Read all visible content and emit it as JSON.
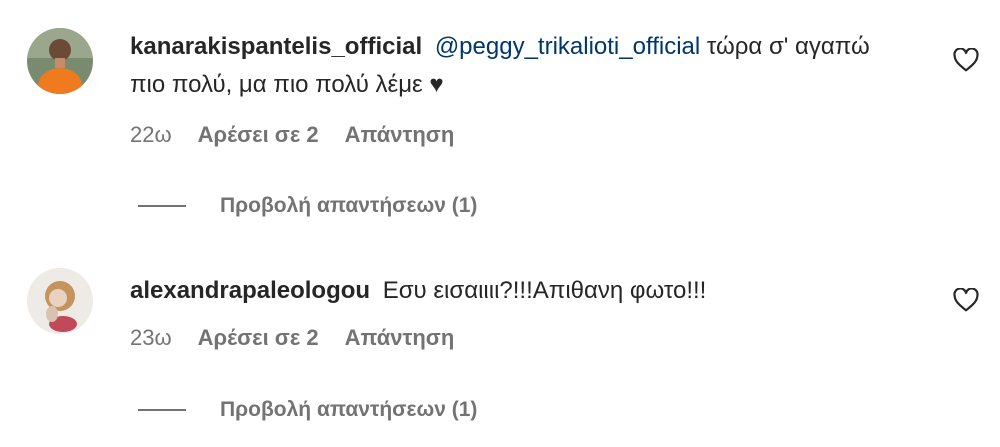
{
  "comments": [
    {
      "username": "kanarakispantelis_official",
      "mention": "@peggy_trikalioti_official",
      "text": " τώρα σ' αγαπώ πιο πολύ, μα πιο πολύ λέμε ♥",
      "time": "22ω",
      "likes": "Αρέσει σε 2",
      "reply": "Απάντηση",
      "view_replies": "Προβολή απαντήσεων (1)",
      "avatar_icon": "user-avatar-orange",
      "heart_icon": "heart-outline-icon"
    },
    {
      "username": "alexandrapaleologou",
      "mention": "",
      "text": "Εσυ εισαιιιι?!!!Απιθανη φωτο!!!",
      "time": "23ω",
      "likes": "Αρέσει σε 2",
      "reply": "Απάντηση",
      "view_replies": "Προβολή απαντήσεων (1)",
      "avatar_icon": "user-avatar-pale",
      "heart_icon": "heart-outline-icon"
    }
  ],
  "colors": {
    "text": "#262626",
    "secondary": "#737373",
    "mention": "#00376b"
  }
}
